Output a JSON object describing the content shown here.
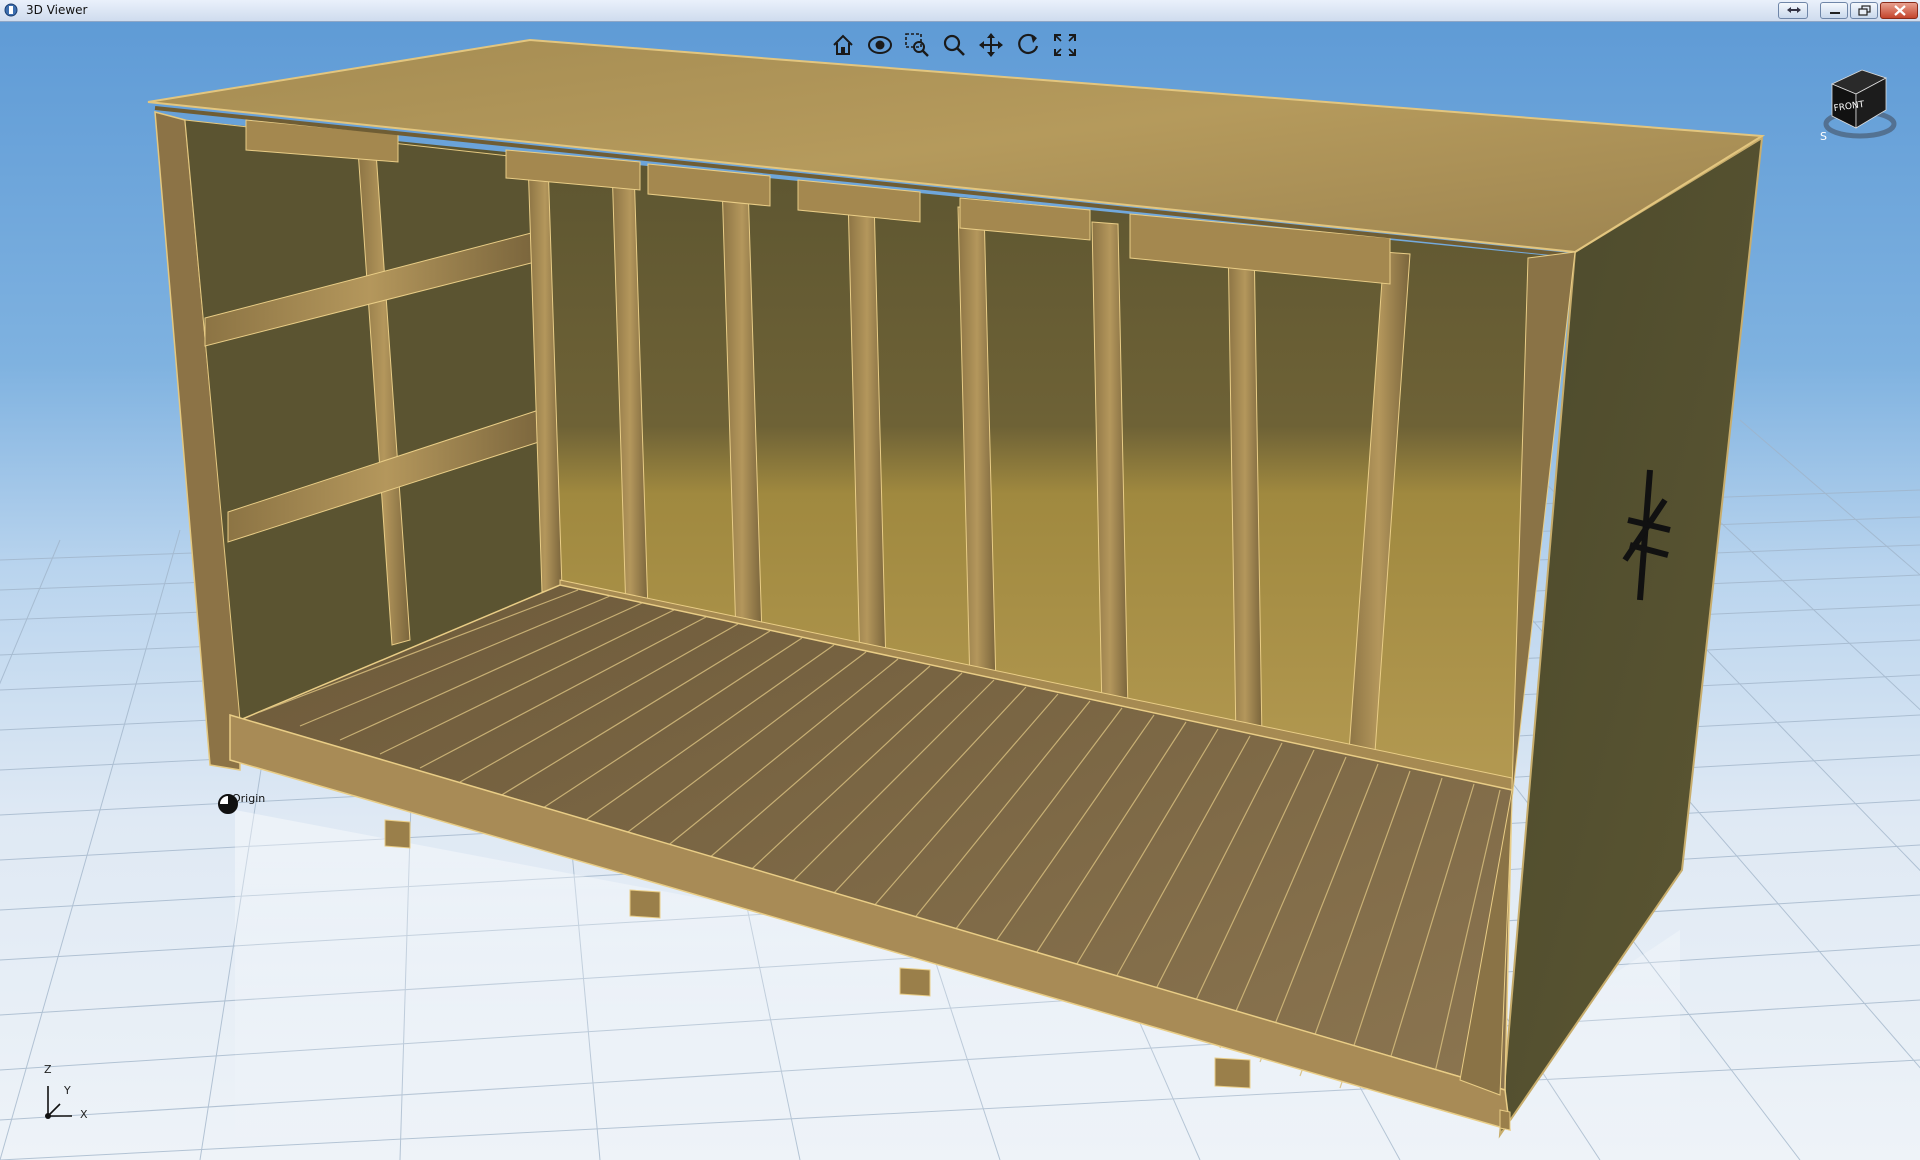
{
  "window": {
    "title": "3D Viewer",
    "controls": [
      "restore-alt",
      "minimize",
      "maximize",
      "close"
    ]
  },
  "toolbar": {
    "buttons": [
      {
        "icon": "home-icon",
        "label": "Home"
      },
      {
        "icon": "look-at-icon",
        "label": "Look At"
      },
      {
        "icon": "zoom-window-icon",
        "label": "Zoom Window"
      },
      {
        "icon": "zoom-icon",
        "label": "Zoom"
      },
      {
        "icon": "pan-icon",
        "label": "Pan"
      },
      {
        "icon": "orbit-icon",
        "label": "Orbit"
      },
      {
        "icon": "fit-all-icon",
        "label": "Fit All"
      }
    ]
  },
  "viewcube": {
    "face_label": "FRONT",
    "compass_label": "S"
  },
  "scene": {
    "origin_label": "Origin",
    "model": "wooden crate (open front and top cut-away)"
  },
  "axes": {
    "x": "X",
    "y": "Y",
    "z": "Z"
  },
  "colors": {
    "sky_top": "#5f9bd6",
    "ground": "#eef3f8",
    "grid_line": "#9fb3c8",
    "wood_light": "#b99a5e",
    "wood_mid": "#9b7f4a",
    "wood_dark": "#5e5530",
    "edge_highlight": "#f2d78a"
  }
}
